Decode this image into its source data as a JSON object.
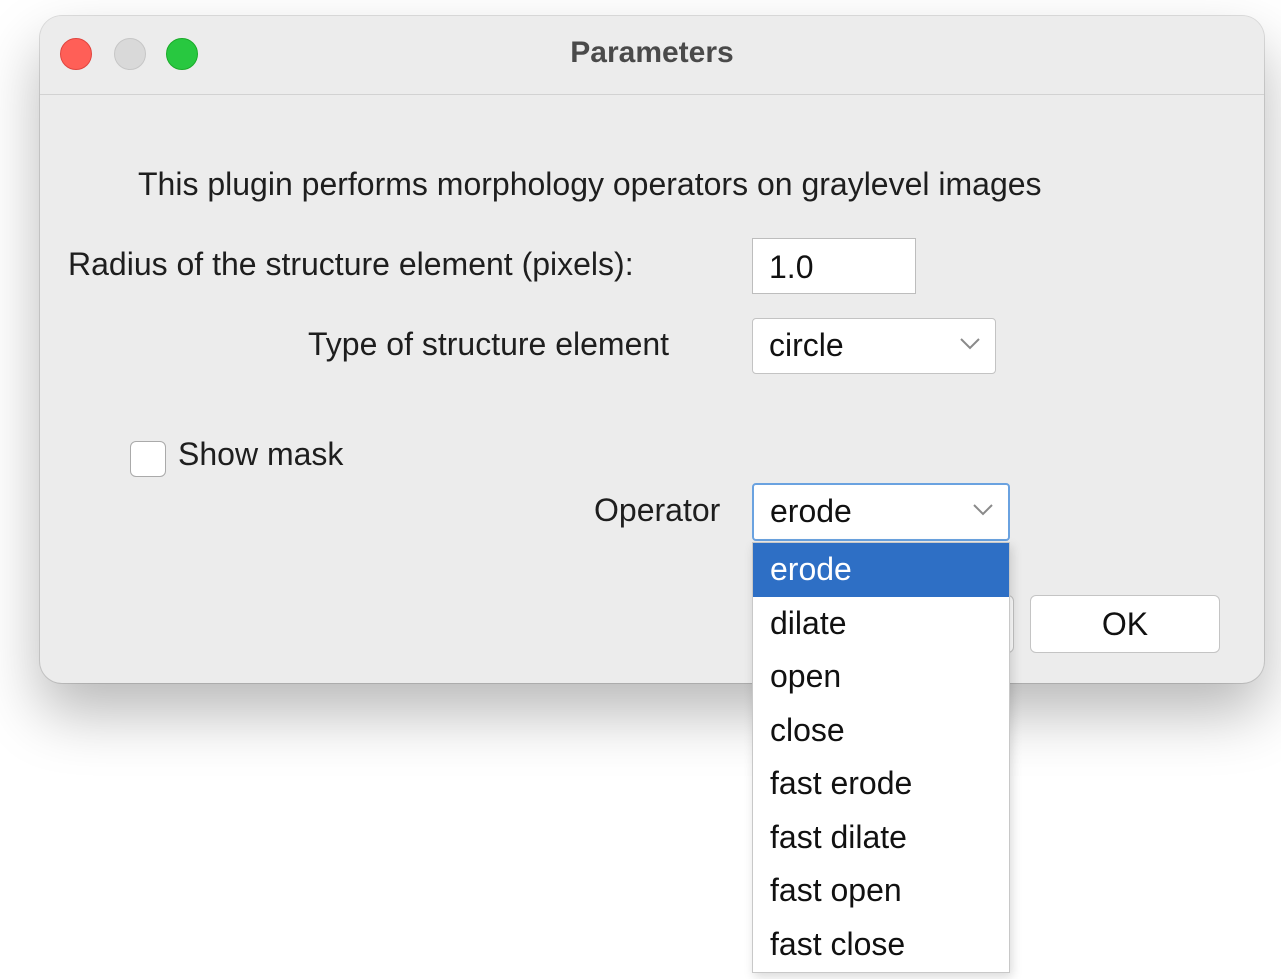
{
  "window": {
    "title": "Parameters"
  },
  "description": "This plugin performs morphology operators on graylevel images",
  "radius": {
    "label": "Radius of the structure element (pixels):",
    "value": "1.0"
  },
  "structure_type": {
    "label": "Type of structure element",
    "selected": "circle"
  },
  "show_mask": {
    "label": "Show mask",
    "checked": false
  },
  "operator": {
    "label": "Operator",
    "selected": "erode",
    "options": [
      "erode",
      "dilate",
      "open",
      "close",
      "fast erode",
      "fast dilate",
      "fast open",
      "fast close"
    ]
  },
  "buttons": {
    "ok": "OK"
  },
  "colors": {
    "selection": "#2e6fc5",
    "close": "#ff5f57",
    "minimize": "#d9d9d9",
    "zoom": "#28c840"
  }
}
